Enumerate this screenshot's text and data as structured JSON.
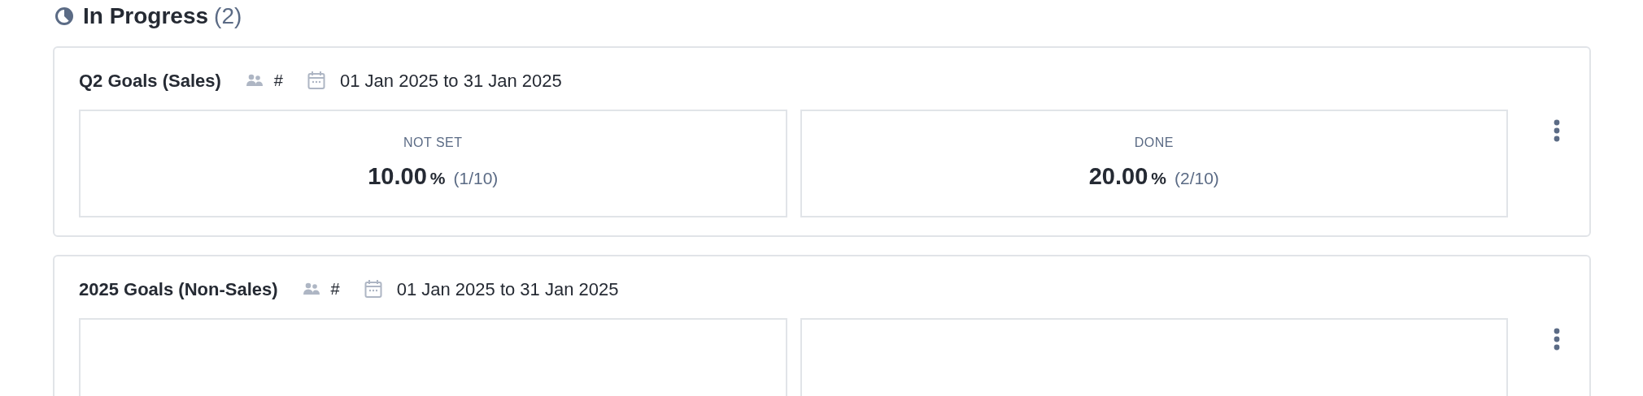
{
  "section": {
    "title": "In Progress",
    "count": "(2)"
  },
  "cards": [
    {
      "title": "Q2 Goals (Sales)",
      "hash": "#",
      "date_range": "01 Jan 2025 to 31 Jan 2025",
      "metrics": [
        {
          "label": "NOT SET",
          "value": "10.00",
          "unit": "%",
          "ratio": "(1/10)"
        },
        {
          "label": "DONE",
          "value": "20.00",
          "unit": "%",
          "ratio": "(2/10)"
        }
      ]
    },
    {
      "title": "2025 Goals (Non-Sales)",
      "hash": "#",
      "date_range": "01 Jan 2025 to 31 Jan 2025"
    }
  ]
}
